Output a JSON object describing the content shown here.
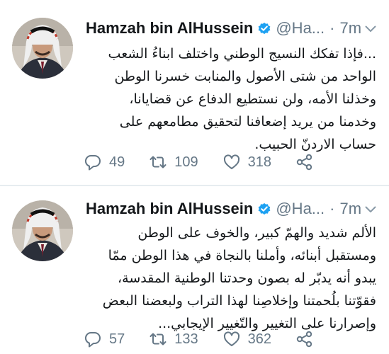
{
  "tweets": [
    {
      "author_name": "Hamzah bin AlHussein",
      "handle": "@Ha...",
      "separator": "·",
      "time": "7m",
      "text_lines": [
        "...فإذا تفكك النسيج الوطني واختلف ابناءُ الشعب",
        "الواحد من شتى الأصول والمنابت خسرنا الوطن",
        "وخذلنا الأمه، ولن نستطيع الدفاع عن قضايانا،",
        "وخدمنا من يريد إضعافنا لتحقيق مطامعهم على",
        "حساب الاردنّ الحبيب."
      ],
      "replies": "49",
      "retweets": "109",
      "likes": "318"
    },
    {
      "author_name": "Hamzah bin AlHussein",
      "handle": "@Ha...",
      "separator": "·",
      "time": "7m",
      "text_lines": [
        "الألم شديد والهمّ كبير، والخوف على الوطن",
        "ومستقبل أبنائه، وأملنا بالنجاة في هذا الوطن ممّا",
        "يبدو أنه يدبّر له بصون وحدتنا الوطنية المقدسة،",
        "فقوّتنا بلُحمتنا وإخلاصِنا لهذا التراب ولبعضنا البعض",
        "وإصرارنا على التغيير والتّغيير الإيجابي..."
      ],
      "replies": "57",
      "retweets": "133",
      "likes": "362"
    }
  ],
  "icons": {
    "verified": "verified-badge-icon",
    "reply": "reply-icon",
    "retweet": "retweet-icon",
    "like": "heart-icon",
    "share": "share-icon",
    "more": "chevron-down-icon"
  },
  "colors": {
    "verified": "#1da1f2",
    "muted": "#657786",
    "text": "#14171a",
    "divider": "#e6ecf0"
  }
}
